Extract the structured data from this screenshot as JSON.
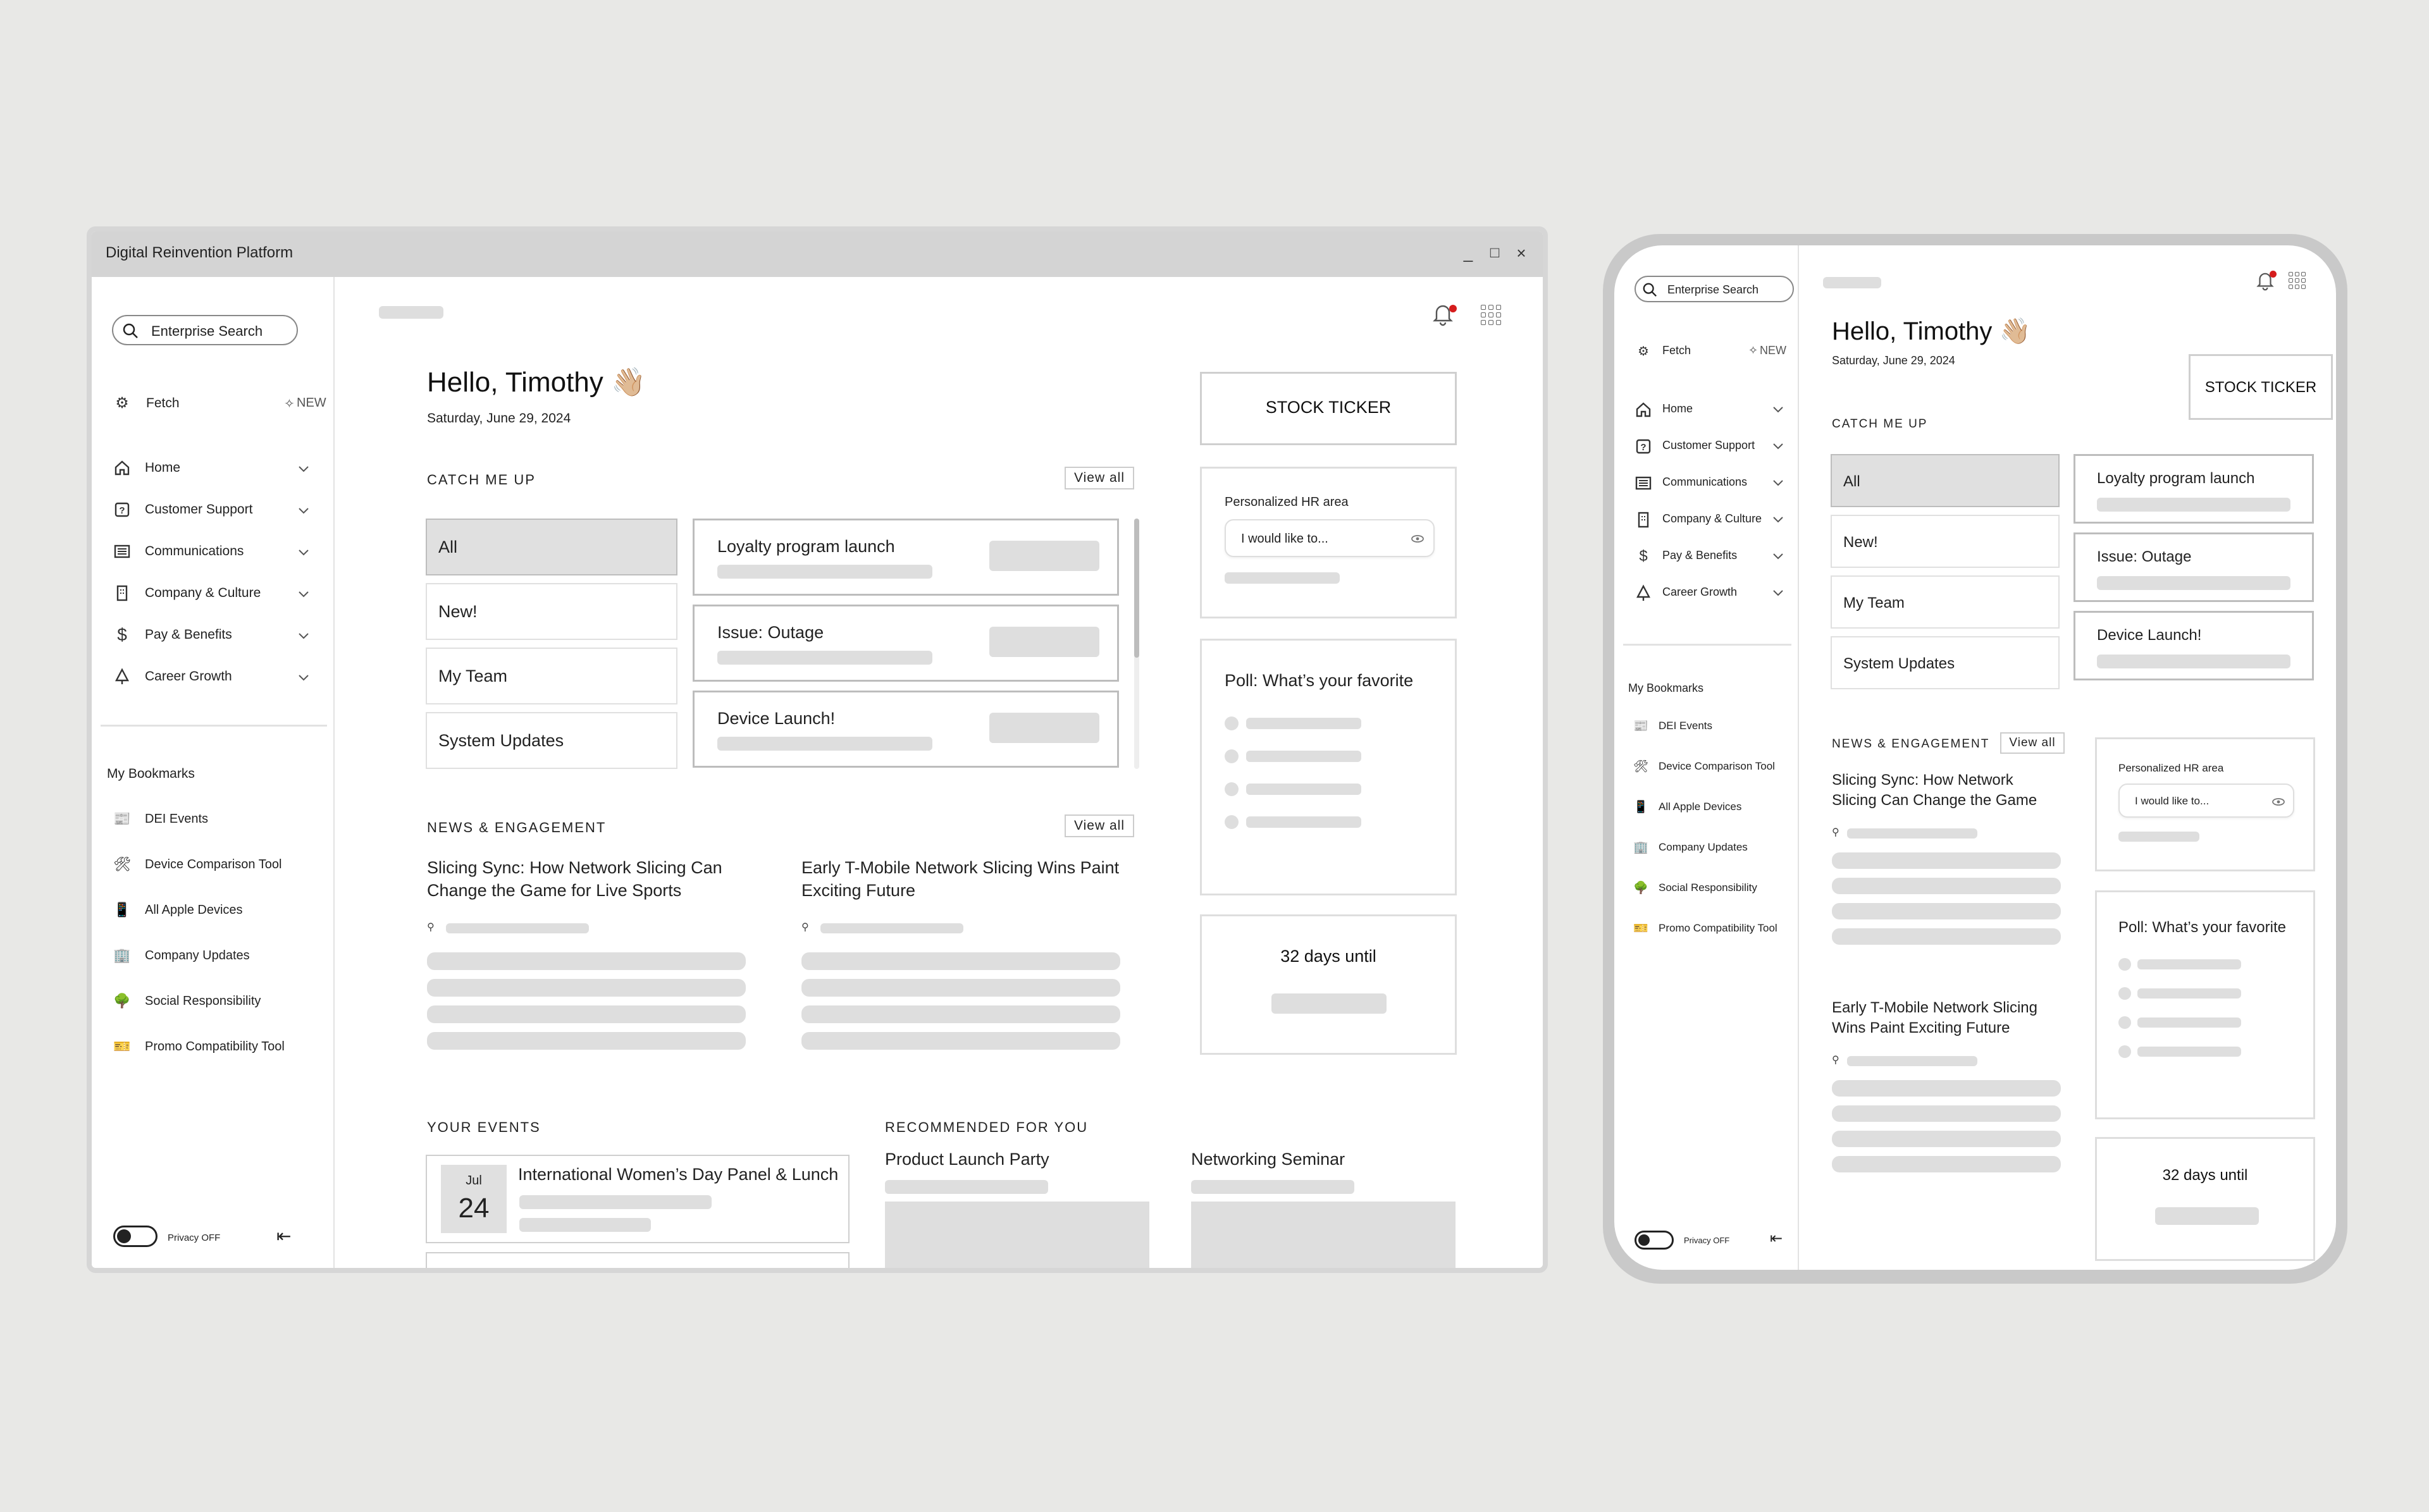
{
  "desktop": {
    "window_title": "Digital Reinvention Platform",
    "window_controls": {
      "minimize": "_",
      "maximize": "□",
      "close": "×"
    },
    "search": {
      "label": "Enterprise Search"
    },
    "fetch": {
      "label": "Fetch",
      "badge": "NEW"
    },
    "nav": [
      {
        "label": "Home",
        "icon": "home-icon"
      },
      {
        "label": "Customer Support",
        "icon": "help-icon"
      },
      {
        "label": "Communications",
        "icon": "newspaper-icon"
      },
      {
        "label": "Company & Culture",
        "icon": "building-icon"
      },
      {
        "label": "Pay & Benefits",
        "icon": "dollar-icon"
      },
      {
        "label": "Career Growth",
        "icon": "tree-icon"
      }
    ],
    "bookmarks_title": "My Bookmarks",
    "bookmarks": [
      {
        "label": "DEI Events",
        "icon": "newspaper-icon",
        "glyph": "📰"
      },
      {
        "label": "Device Comparison Tool",
        "icon": "tools-icon",
        "glyph": "🛠"
      },
      {
        "label": "All Apple Devices",
        "icon": "phone-icon",
        "glyph": "📱"
      },
      {
        "label": "Company Updates",
        "icon": "office-icon",
        "glyph": "🏢"
      },
      {
        "label": "Social Responsibility",
        "icon": "tree-icon",
        "glyph": "🌳"
      },
      {
        "label": "Promo Compatibility Tool",
        "icon": "ticket-icon",
        "glyph": "🎫"
      }
    ],
    "privacy": {
      "label": "Privacy OFF",
      "state": "off"
    },
    "greeting": "Hello, Timothy",
    "greeting_emoji": "👋🏼",
    "date": "Saturday, June 29, 2024",
    "catch_up": {
      "title": "CATCH ME UP",
      "view_all": "View all",
      "filters": [
        "All",
        "New!",
        "My Team",
        "System Updates"
      ],
      "cards": [
        "Loyalty program launch",
        "Issue: Outage",
        "Device Launch!"
      ]
    },
    "news": {
      "title": "NEWS & ENGAGEMENT",
      "view_all": "View all",
      "articles": [
        "Slicing Sync: How Network Slicing Can Change the Game for Live Sports",
        "Early T-Mobile Network Slicing Wins Paint Exciting Future"
      ]
    },
    "events": {
      "title": "YOUR EVENTS",
      "items": [
        {
          "month": "Jul",
          "day": "24",
          "title": "International Women’s Day Panel & Lunch"
        }
      ]
    },
    "recommended": {
      "title": "RECOMMENDED FOR YOU",
      "items": [
        "Product Launch Party",
        "Networking Seminar"
      ]
    },
    "stock_ticker": "STOCK TICKER",
    "hr": {
      "title": "Personalized HR area",
      "placeholder": "I would like to..."
    },
    "poll": {
      "title": "Poll: What’s your favorite"
    },
    "countdown": "32 days until"
  },
  "tablet": {
    "search": "Enterprise Search",
    "fetch": "Fetch",
    "fetch_badge": "NEW",
    "nav": [
      "Home",
      "Customer Support",
      "Communications",
      "Company & Culture",
      "Pay & Benefits",
      "Career Growth"
    ],
    "bookmarks_title": "My Bookmarks",
    "bookmarks": [
      "DEI Events",
      "Device Comparison Tool",
      "All Apple Devices",
      "Company Updates",
      "Social Responsibility",
      "Promo Compatibility Tool"
    ],
    "privacy": "Privacy OFF",
    "greeting": "Hello, Timothy",
    "date": "Saturday, June 29, 2024",
    "stock_ticker": "STOCK TICKER",
    "catch_up_title": "CATCH ME UP",
    "filters": [
      "All",
      "New!",
      "My Team",
      "System Updates"
    ],
    "cards": [
      "Loyalty program launch",
      "Issue: Outage",
      "Device Launch!"
    ],
    "news_title": "NEWS & ENGAGEMENT",
    "view_all": "View all",
    "articles": [
      "Slicing Sync: How Network Slicing Can Change the Game",
      "Early T-Mobile Network Slicing Wins Paint Exciting Future"
    ],
    "hr_title": "Personalized HR area",
    "hr_placeholder": "I would like to...",
    "poll_title": "Poll: What’s your favorite",
    "countdown": "32 days until"
  },
  "colors": {
    "accent_red": "#d51c1c",
    "skeleton": "#dedede",
    "background": "#e8e8e6"
  }
}
